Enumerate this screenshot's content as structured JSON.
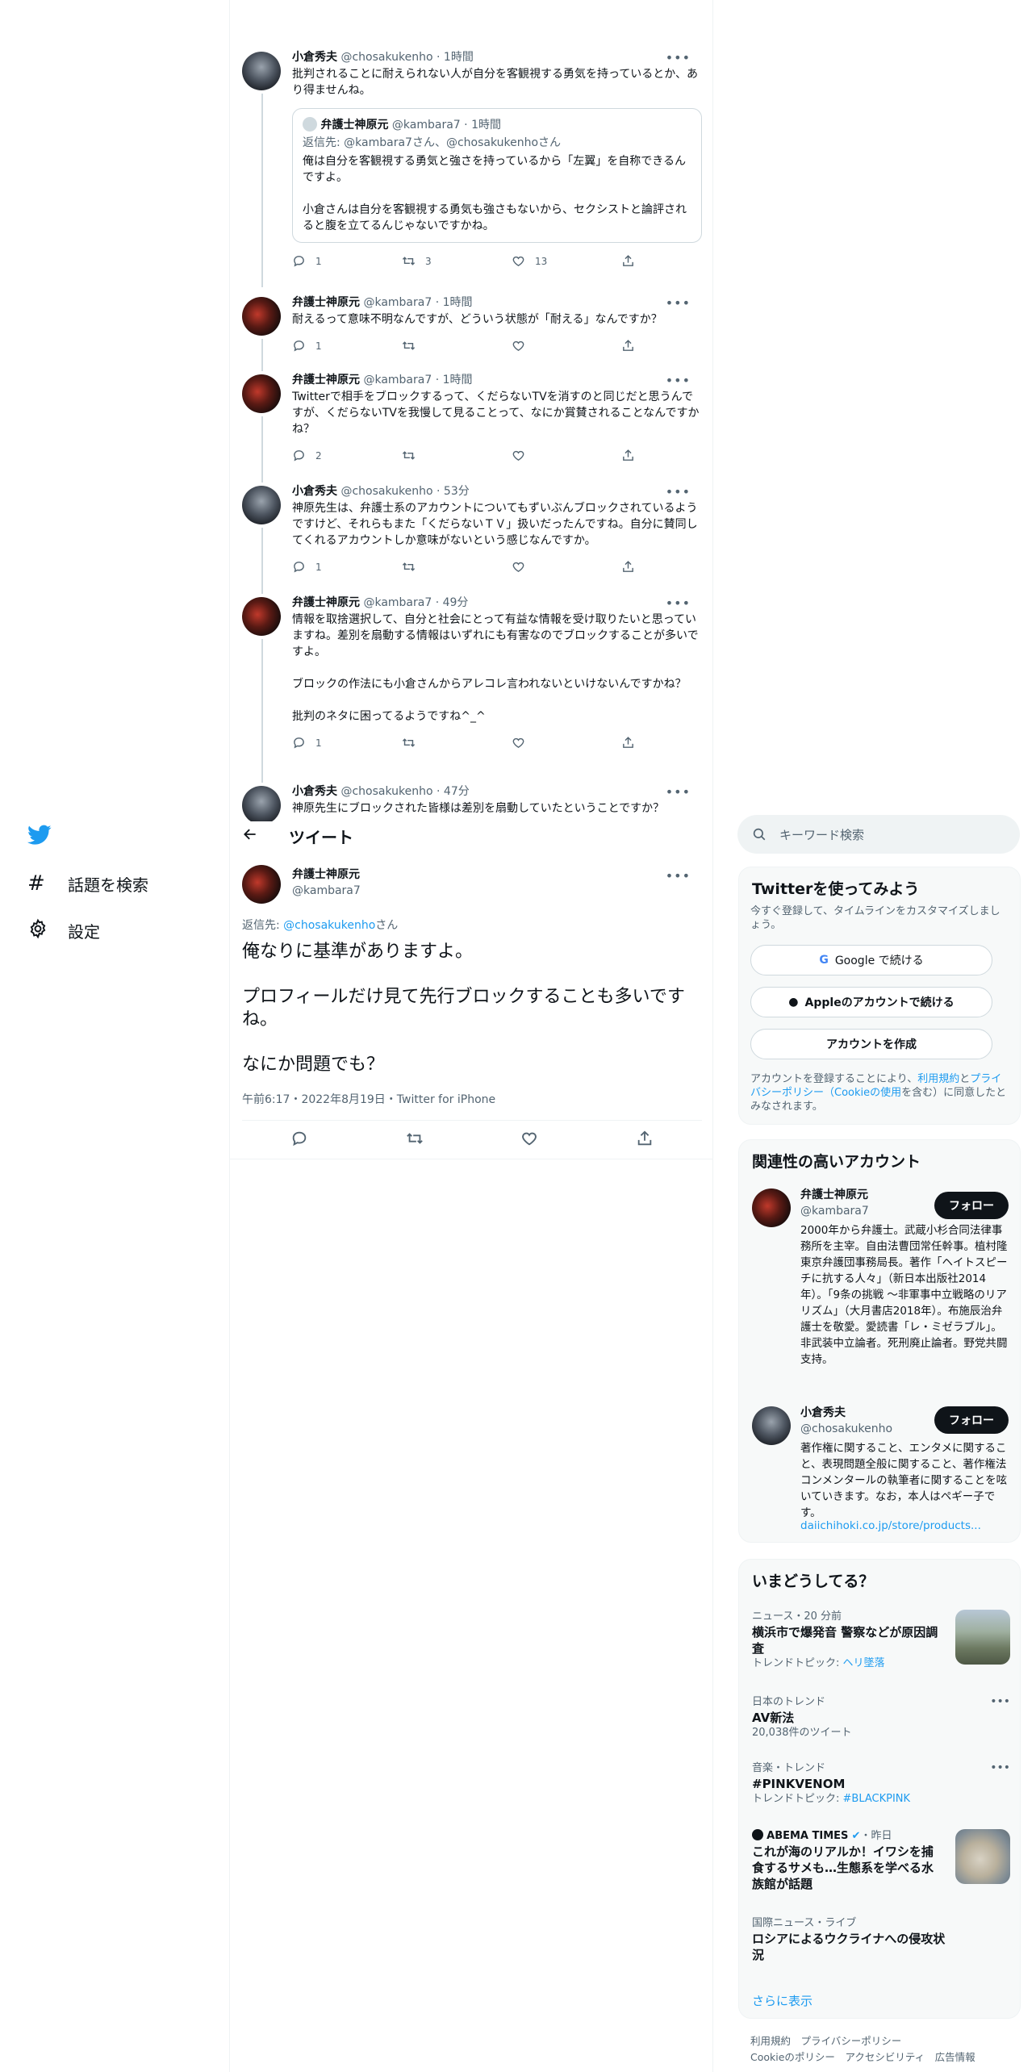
{
  "nav": {
    "explore": "話題を検索",
    "settings": "設定"
  },
  "thread": [
    {
      "name": "小倉秀夫",
      "handle": "@chosakukenho",
      "time": "1時間",
      "text": "批判されることに耐えられない人が自分を客観視する勇気を持っているとか、あり得ませんね。",
      "replies": "1",
      "retweets": "3",
      "likes": "13",
      "quote": {
        "name": "弁護士神原元",
        "handle": "@kambara7",
        "time": "1時間",
        "reply_prefix": "返信先: ",
        "reply_to": "@kambara7さん、@chosakukenhoさん",
        "text": "俺は自分を客観視する勇気と強さを持っているから「左翼」を自称できるんですよ。\n\n小倉さんは自分を客観視する勇気も強さもないから、セクシストと論評されると腹を立てるんじゃないですかね。"
      }
    },
    {
      "name": "弁護士神原元",
      "handle": "@kambara7",
      "time": "1時間",
      "text": "耐えるって意味不明なんですが、どういう状態が「耐える」なんですか？",
      "replies": "1"
    },
    {
      "name": "弁護士神原元",
      "handle": "@kambara7",
      "time": "1時間",
      "text": "Twitterで相手をブロックするって、くだらないTVを消すのと同じだと思うんですが、くだらないTVを我慢して見ることって、なにか賞賛されることなんですかね？",
      "replies": "2"
    },
    {
      "name": "小倉秀夫",
      "handle": "@chosakukenho",
      "time": "53分",
      "text": "神原先生は、弁護士系のアカウントについてもずいぶんブロックされているようですけど、それらもまた「くだらないＴＶ」扱いだったんですね。自分に賛同してくれるアカウントしか意味がないという感じなんですか。",
      "replies": "1"
    },
    {
      "name": "弁護士神原元",
      "handle": "@kambara7",
      "time": "49分",
      "text": "情報を取捨選択して、自分と社会にとって有益な情報を受け取りたいと思っていますね。差別を扇動する情報はいずれにも有害なのでブロックすることが多いですよ。\n\nブロックの作法にも小倉さんからアレコレ言われないといけないんですかね？\n\n批判のネタに困ってるようですね^_^",
      "replies": "1"
    },
    {
      "name": "小倉秀夫",
      "handle": "@chosakukenho",
      "time": "47分",
      "text": "神原先生にブロックされた皆様は差別を扇動していたということですか？"
    }
  ],
  "header": {
    "title": "ツイート"
  },
  "focus": {
    "name": "弁護士神原元",
    "handle": "@kambara7",
    "reply_prefix": "返信先: ",
    "reply_to": "@chosakukenho",
    "reply_suffix": "さん",
    "text": "俺なりに基準がありますよ。\n\nプロフィールだけ見て先行ブロックすることも多いですね。\n\nなにか問題でも？",
    "meta": "午前6:17・2022年8月19日・Twitter for iPhone"
  },
  "search": {
    "placeholder": "キーワード検索"
  },
  "signup": {
    "title": "Twitterを使ってみよう",
    "subtitle": "今すぐ登録して、タイムラインをカスタマイズしましょう。",
    "google": "Google で続ける",
    "apple": "Appleのアカウントで続ける",
    "create": "アカウントを作成",
    "legal_a": "アカウントを登録することにより、",
    "legal_terms": "利用規約",
    "legal_and": "と",
    "legal_privacy": "プライバシーポリシー（Cookieの使用",
    "legal_b": "を含む）に同意したとみなされます。"
  },
  "related": {
    "title": "関連性の高いアカウント",
    "follow": "フォロー",
    "accounts": [
      {
        "name": "弁護士神原元",
        "handle": "@kambara7",
        "bio": "2000年から弁護士。武蔵小杉合同法律事務所を主宰。自由法曹団常任幹事。植村隆東京弁護団事務局長。著作「ヘイトスピーチに抗する人々」（新日本出版社2014年）。「9条の挑戦 ～非軍事中立戦略のリアリズム」（大月書店2018年）。布施辰治弁護士を敬愛。愛読書「レ・ミゼラブル」。非武装中立論者。死刑廃止論者。野党共闘支持。"
      },
      {
        "name": "小倉秀夫",
        "handle": "@chosakukenho",
        "bio": "著作権に関すること、エンタメに関すること、表現問題全般に関すること、著作権法コンメンタールの執筆者に関することを呟いていきます。なお，本人はペギー子です。",
        "link": "daiichihoki.co.jp/store/products..."
      }
    ]
  },
  "trends": {
    "title": "いまどうしてる？",
    "items": [
      {
        "context": "ニュース・20 分前",
        "title": "横浜市で爆発音 警察などが原因調査",
        "sub_label": "トレンドトピック: ",
        "sub_link": "ヘリ墜落"
      },
      {
        "context": "日本のトレンド",
        "title": "AV新法",
        "sub": "20,038件のツイート"
      },
      {
        "context": "音楽・トレンド",
        "title": "#PINKVENOM",
        "sub_label": "トレンドトピック: ",
        "sub_link": "#BLACKPINK"
      },
      {
        "context": "ABEMA TIMES",
        "context_time": "・昨日",
        "title": "これが海のリアルか！イワシを捕食するサメも…生態系を学べる水族館が話題"
      },
      {
        "context": "国際ニュース・ライブ",
        "title": "ロシアによるウクライナへの侵攻状況"
      }
    ],
    "show_more": "さらに表示"
  },
  "footer": {
    "terms": "利用規約",
    "privacy": "プライバシーポリシー",
    "cookie": "Cookieのポリシー",
    "accessibility": "アクセシビリティ",
    "ads": "広告情報"
  }
}
